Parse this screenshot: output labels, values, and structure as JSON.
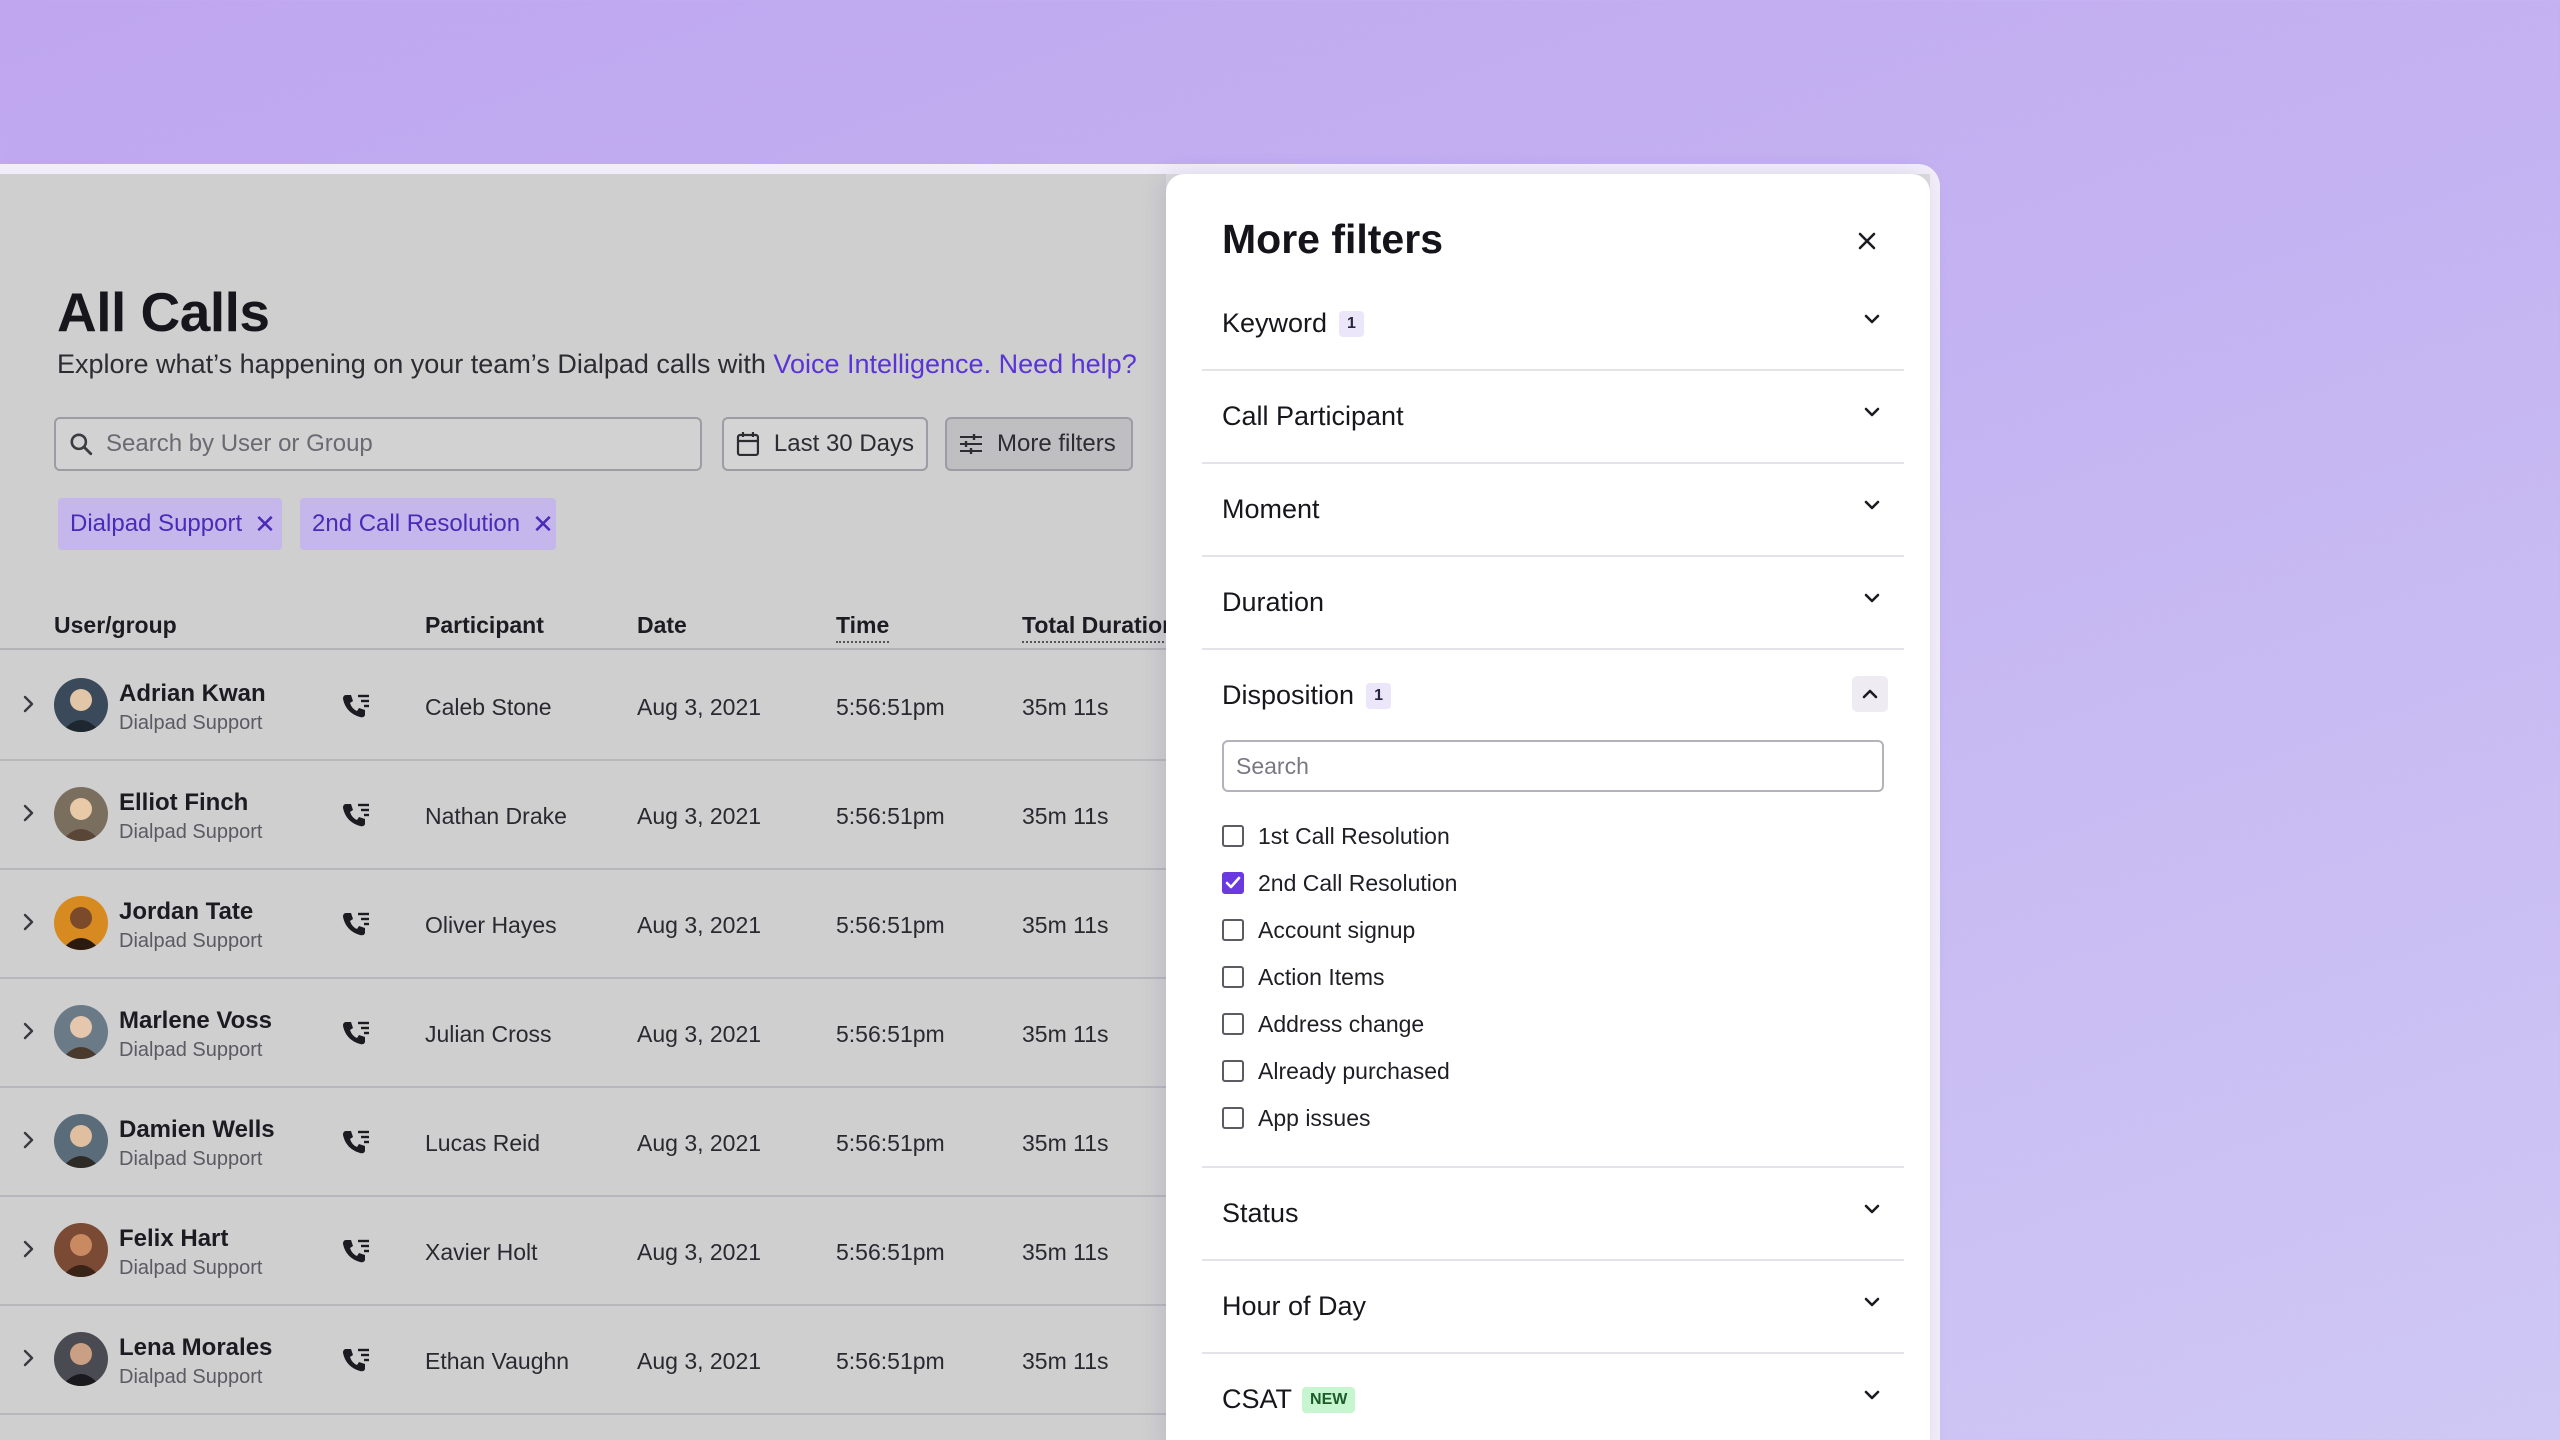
{
  "page": {
    "title": "All Calls",
    "subtitle_text": "Explore what’s happening on your team’s Dialpad calls with ",
    "subtitle_link1": "Voice Intelligence.",
    "subtitle_link2": "Need help?"
  },
  "toolbar": {
    "search_placeholder": "Search by User or Group",
    "date_button": "Last 30 Days",
    "more_filters_button": "More filters"
  },
  "active_filters": [
    {
      "label": "Dialpad Support"
    },
    {
      "label": "2nd Call Resolution"
    }
  ],
  "table": {
    "columns": [
      "User/group",
      "Participant",
      "Date",
      "Time",
      "Total Duration"
    ],
    "rows": [
      {
        "name": "Adrian Kwan",
        "group": "Dialpad Support",
        "participant": "Caleb Stone",
        "date": "Aug 3, 2021",
        "time": "5:56:51pm",
        "duration": "35m 11s"
      },
      {
        "name": "Elliot Finch",
        "group": "Dialpad Support",
        "participant": "Nathan Drake",
        "date": "Aug 3, 2021",
        "time": "5:56:51pm",
        "duration": "35m 11s"
      },
      {
        "name": "Jordan Tate",
        "group": "Dialpad Support",
        "participant": "Oliver Hayes",
        "date": "Aug 3, 2021",
        "time": "5:56:51pm",
        "duration": "35m 11s"
      },
      {
        "name": "Marlene Voss",
        "group": "Dialpad Support",
        "participant": "Julian Cross",
        "date": "Aug 3, 2021",
        "time": "5:56:51pm",
        "duration": "35m 11s"
      },
      {
        "name": "Damien Wells",
        "group": "Dialpad Support",
        "participant": "Lucas Reid",
        "date": "Aug 3, 2021",
        "time": "5:56:51pm",
        "duration": "35m 11s"
      },
      {
        "name": "Felix Hart",
        "group": "Dialpad Support",
        "participant": "Xavier Holt",
        "date": "Aug 3, 2021",
        "time": "5:56:51pm",
        "duration": "35m 11s"
      },
      {
        "name": "Lena Morales",
        "group": "Dialpad Support",
        "participant": "Ethan Vaughn",
        "date": "Aug 3, 2021",
        "time": "5:56:51pm",
        "duration": "35m 11s"
      }
    ]
  },
  "drawer": {
    "title": "More filters",
    "sections": {
      "keyword": {
        "label": "Keyword",
        "badge": "1"
      },
      "call_participant": {
        "label": "Call Participant"
      },
      "moment": {
        "label": "Moment"
      },
      "duration": {
        "label": "Duration"
      },
      "disposition": {
        "label": "Disposition",
        "badge": "1",
        "search_placeholder": "Search",
        "options": [
          {
            "label": "1st Call Resolution",
            "checked": false
          },
          {
            "label": "2nd Call Resolution",
            "checked": true
          },
          {
            "label": "Account signup",
            "checked": false
          },
          {
            "label": "Action Items",
            "checked": false
          },
          {
            "label": "Address change",
            "checked": false
          },
          {
            "label": "Already purchased",
            "checked": false
          },
          {
            "label": "App issues",
            "checked": false
          }
        ]
      },
      "status": {
        "label": "Status"
      },
      "hour_of_day": {
        "label": "Hour of Day"
      },
      "csat": {
        "label": "CSAT",
        "badge": "NEW"
      }
    }
  },
  "colors": {
    "accent": "#6a3ae0",
    "link": "#5a34d6",
    "chip_bg": "#c5b7ec",
    "new_badge_bg": "#c6f5cf"
  }
}
